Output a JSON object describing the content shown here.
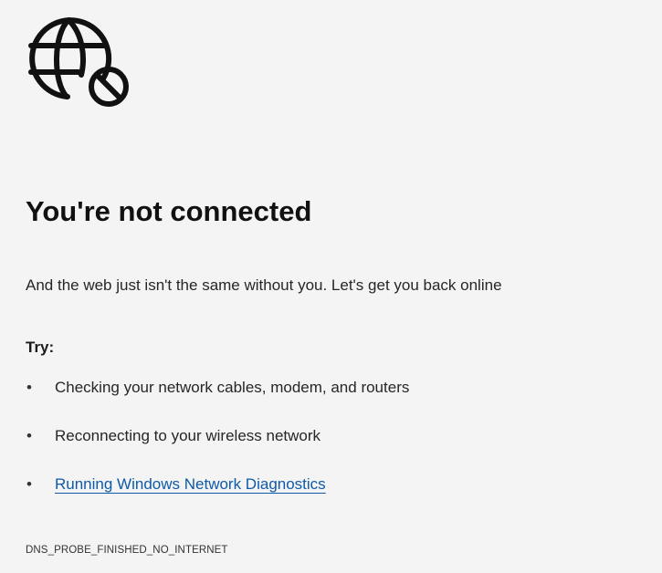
{
  "page": {
    "icon": "globe-blocked-icon",
    "title": "You're not connected",
    "subtitle": "And the web just isn't the same without you. Let's get you back online",
    "try_label": "Try:",
    "suggestions": [
      {
        "bullet": "•",
        "text": "Checking your network cables, modem, and routers"
      },
      {
        "bullet": "•",
        "text": "Reconnecting to your wireless network"
      },
      {
        "bullet": "•",
        "text": "Running Windows Network Diagnostics"
      }
    ],
    "error_code": "DNS_PROBE_FINISHED_NO_INTERNET"
  },
  "colors": {
    "background": "#f4f4f4",
    "text": "#1b1b1b",
    "link": "#0f5aa8"
  }
}
